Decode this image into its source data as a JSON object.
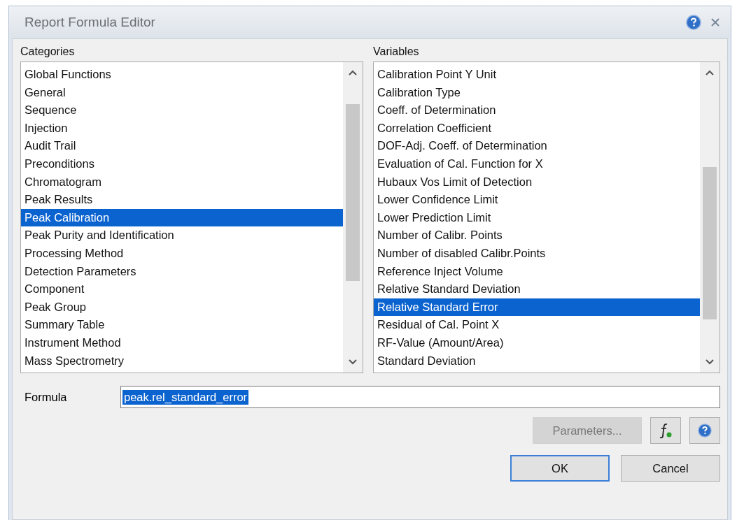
{
  "window": {
    "title": "Report Formula Editor"
  },
  "categories": {
    "label": "Categories",
    "items": [
      {
        "label": "Global Functions",
        "selected": false
      },
      {
        "label": "General",
        "selected": false
      },
      {
        "label": "Sequence",
        "selected": false
      },
      {
        "label": "Injection",
        "selected": false
      },
      {
        "label": "Audit Trail",
        "selected": false
      },
      {
        "label": "Preconditions",
        "selected": false
      },
      {
        "label": "Chromatogram",
        "selected": false
      },
      {
        "label": "Peak Results",
        "selected": false
      },
      {
        "label": "Peak Calibration",
        "selected": true
      },
      {
        "label": "Peak Purity and Identification",
        "selected": false
      },
      {
        "label": "Processing Method",
        "selected": false
      },
      {
        "label": "Detection Parameters",
        "selected": false
      },
      {
        "label": "Component",
        "selected": false
      },
      {
        "label": "Peak Group",
        "selected": false
      },
      {
        "label": "Summary Table",
        "selected": false
      },
      {
        "label": "Instrument Method",
        "selected": false
      },
      {
        "label": "Mass Spectrometry",
        "selected": false
      }
    ]
  },
  "variables": {
    "label": "Variables",
    "items": [
      {
        "label": "Calibration Point Y Unit",
        "selected": false
      },
      {
        "label": "Calibration Type",
        "selected": false
      },
      {
        "label": "Coeff. of Determination",
        "selected": false
      },
      {
        "label": "Correlation Coefficient",
        "selected": false
      },
      {
        "label": "DOF-Adj. Coeff. of Determination",
        "selected": false
      },
      {
        "label": "Evaluation of Cal. Function for X",
        "selected": false
      },
      {
        "label": "Hubaux Vos Limit of Detection",
        "selected": false
      },
      {
        "label": "Lower Confidence Limit",
        "selected": false
      },
      {
        "label": "Lower Prediction Limit",
        "selected": false
      },
      {
        "label": "Number of Calibr. Points",
        "selected": false
      },
      {
        "label": "Number of disabled Calibr.Points",
        "selected": false
      },
      {
        "label": "Reference Inject Volume",
        "selected": false
      },
      {
        "label": "Relative Standard Deviation",
        "selected": false
      },
      {
        "label": "Relative Standard Error",
        "selected": true
      },
      {
        "label": "Residual of Cal. Point X",
        "selected": false
      },
      {
        "label": "RF-Value (Amount/Area)",
        "selected": false
      },
      {
        "label": "Standard Deviation",
        "selected": false
      }
    ]
  },
  "formula": {
    "label": "Formula",
    "value": "peak.rel_standard_error"
  },
  "buttons": {
    "parameters": {
      "label": "Parameters...",
      "disabled": true
    },
    "ok": "OK",
    "cancel": "Cancel"
  }
}
